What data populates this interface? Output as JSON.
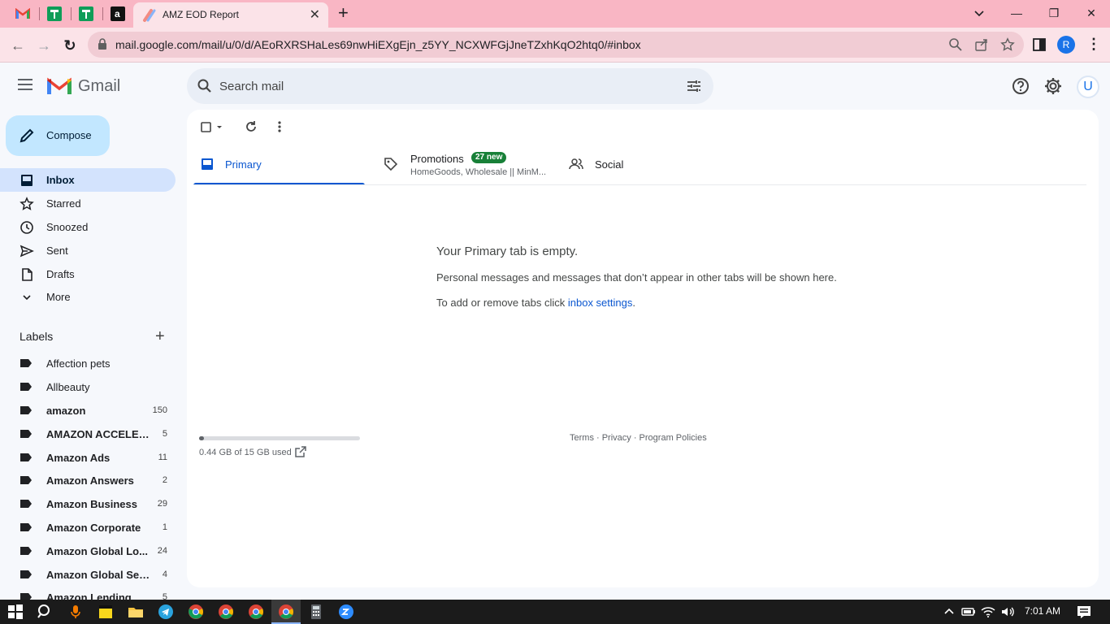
{
  "browser": {
    "tabs": [
      {
        "title": "AMZ EOD Report",
        "active": true
      }
    ],
    "address": "mail.google.com/mail/u/0/d/AEoRXRSHaLes69nwHiEXgEjn_z5YY_NCXWFGjJneTZxhKqO2htq0/#inbox",
    "profile_initial": "R",
    "window_controls": {
      "minimize": "—",
      "restore": "❐",
      "close": "✕"
    },
    "tab_close": "✕",
    "new_tab": "+",
    "back": "←",
    "forward": "→",
    "reload": "↻",
    "menu": "⋮"
  },
  "gmail": {
    "app_name": "Gmail",
    "search_placeholder": "Search mail",
    "account_initial": "U",
    "compose_label": "Compose",
    "nav": [
      {
        "label": "Inbox",
        "icon": "inbox-icon",
        "active": true
      },
      {
        "label": "Starred",
        "icon": "star-icon"
      },
      {
        "label": "Snoozed",
        "icon": "clock-icon"
      },
      {
        "label": "Sent",
        "icon": "send-icon"
      },
      {
        "label": "Drafts",
        "icon": "draft-icon"
      },
      {
        "label": "More",
        "icon": "chevron-down-icon"
      }
    ],
    "labels_heading": "Labels",
    "labels_add": "+",
    "labels": [
      {
        "name": "Affection pets",
        "count": "",
        "bold": false
      },
      {
        "name": "Allbeauty",
        "count": "",
        "bold": false
      },
      {
        "name": "amazon",
        "count": "150",
        "bold": true
      },
      {
        "name": "AMAZON ACCELER...",
        "count": "5",
        "bold": true
      },
      {
        "name": "Amazon Ads",
        "count": "11",
        "bold": true
      },
      {
        "name": "Amazon Answers",
        "count": "2",
        "bold": true
      },
      {
        "name": "Amazon Business",
        "count": "29",
        "bold": true
      },
      {
        "name": "Amazon Corporate",
        "count": "1",
        "bold": true
      },
      {
        "name": "Amazon Global Lo...",
        "count": "24",
        "bold": true
      },
      {
        "name": "Amazon Global Sell...",
        "count": "4",
        "bold": true
      },
      {
        "name": "Amazon Lending",
        "count": "5",
        "bold": true
      }
    ],
    "tabs": {
      "primary": "Primary",
      "promotions": "Promotions",
      "promotions_badge": "27 new",
      "promotions_sub": "HomeGoods, Wholesale || MinM...",
      "social": "Social"
    },
    "empty": {
      "title": "Your Primary tab is empty.",
      "body": "Personal messages and messages that don’t appear in other tabs will be shown here.",
      "hint_prefix": "To add or remove tabs click ",
      "hint_link": "inbox settings",
      "hint_suffix": "."
    },
    "storage": {
      "text": "0.44 GB of 15 GB used",
      "fraction": 0.03
    },
    "footer": "Terms · Privacy · Program Policies"
  },
  "taskbar": {
    "clock": "7:01 AM"
  }
}
